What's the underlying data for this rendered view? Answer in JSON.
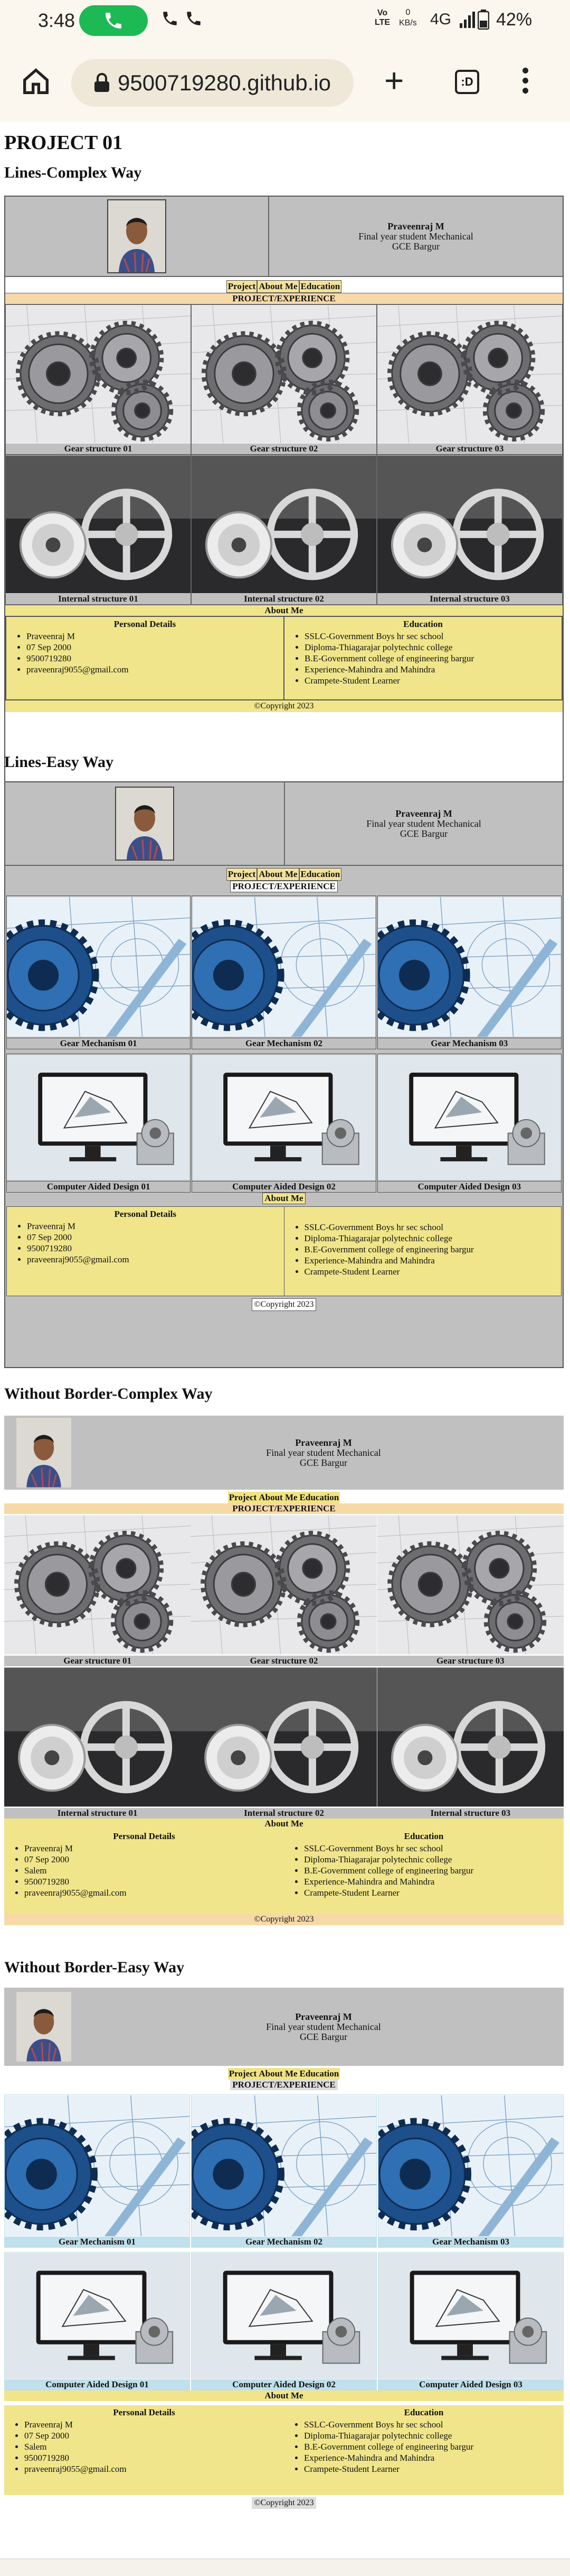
{
  "status": {
    "time": "3:48",
    "volte": "Vo\nLTE",
    "kbs": "0\nKB/s",
    "network": "4G",
    "battery": "42%"
  },
  "browser": {
    "url": "9500719280.github.io",
    "tabs_count": ":D"
  },
  "page_title": "PROJECT 01",
  "profile": {
    "name": "Praveenraj M",
    "role": "Final year student Mechanical",
    "college": "GCE Bargur"
  },
  "nav": [
    "Project",
    "About Me",
    "Education"
  ],
  "project_heading": "PROJECT/EXPERIENCE",
  "about_heading": "About Me",
  "personal_heading": "Personal Details",
  "education_heading": "Education",
  "personal_full": [
    "Praveenraj M",
    "07 Sep 2000",
    "Salem",
    "9500719280",
    "praveenraj9055@gmail.com"
  ],
  "personal_short": [
    "Praveenraj M",
    "07 Sep 2000",
    "9500719280",
    "praveenraj9055@gmail.com"
  ],
  "education_list": [
    "SSLC-Government Boys hr sec school",
    "Diploma-Thiagarajar polytechnic college",
    "B.E-Government college of engineering bargur",
    "Experience-Mahindra and Mahindra",
    "Crampete-Student Learner"
  ],
  "copyright": "©Copyright 2023",
  "sections": [
    {
      "heading": "Lines-Complex Way",
      "row1": [
        "Gear structure 01",
        "Gear structure 02",
        "Gear structure 03"
      ],
      "row2": [
        "Internal structure 01",
        "Internal structure 02",
        "Internal structure 03"
      ]
    },
    {
      "heading": "Lines-Easy Way",
      "row1": [
        "Gear Mechanism 01",
        "Gear Mechanism 02",
        "Gear Mechanism 03"
      ],
      "row2": [
        "Computer Aided Design 01",
        "Computer Aided Design 02",
        "Computer Aided Design 03"
      ]
    },
    {
      "heading": "Without Border-Complex Way",
      "row1": [
        "Gear structure 01",
        "Gear structure 02",
        "Gear structure 03"
      ],
      "row2": [
        "Internal structure 01",
        "Internal structure 02",
        "Internal structure 03"
      ]
    },
    {
      "heading": "Without Border-Easy Way",
      "row1": [
        "Gear Mechanism 01",
        "Gear Mechanism 02",
        "Gear Mechanism 03"
      ],
      "row2": [
        "Computer Aided Design 01",
        "Computer Aided Design 02",
        "Computer Aided Design 03"
      ]
    }
  ],
  "colors": {
    "yellow": "#f0e58a",
    "grey": "#c0c0c0",
    "peach": "#f7d9a8",
    "lightblue": "#bfe0ec"
  }
}
